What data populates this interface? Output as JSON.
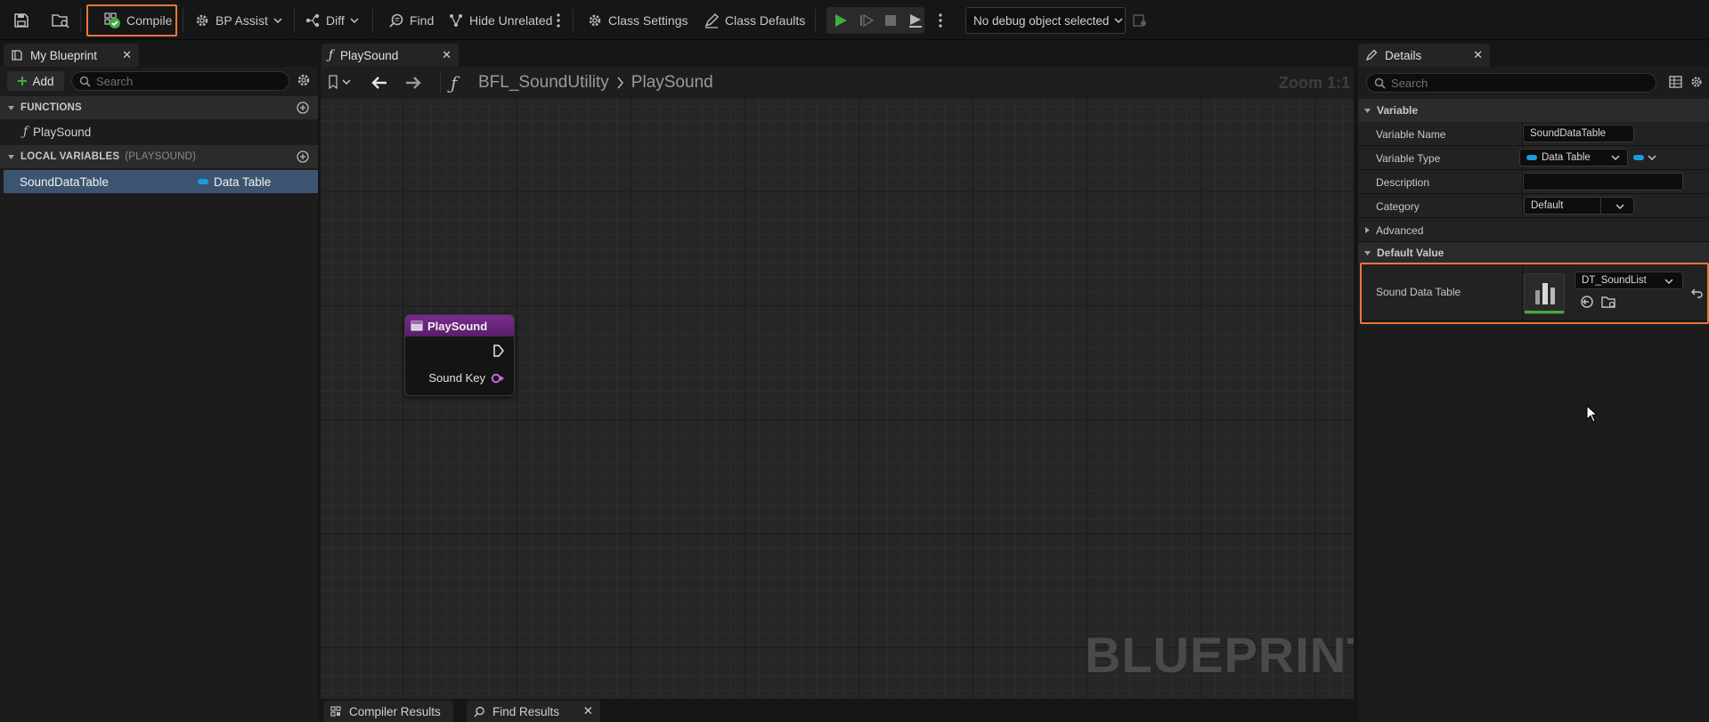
{
  "toolbar": {
    "compile": "Compile",
    "bp_assist": "BP Assist",
    "diff": "Diff",
    "find": "Find",
    "hide_unrelated": "Hide Unrelated",
    "class_settings": "Class Settings",
    "class_defaults": "Class Defaults",
    "debug_object": "No debug object selected"
  },
  "my_blueprint": {
    "tab_title": "My Blueprint",
    "add_label": "Add",
    "search_placeholder": "Search",
    "functions_header": "FUNCTIONS",
    "functions": [
      "PlaySound"
    ],
    "local_vars_header": "LOCAL VARIABLES",
    "local_vars_context": "(PLAYSOUND)",
    "local_vars": [
      {
        "name": "SoundDataTable",
        "type": "Data Table"
      }
    ]
  },
  "graph": {
    "tab_title": "PlaySound",
    "breadcrumb_root": "BFL_SoundUtility",
    "breadcrumb_current": "PlaySound",
    "zoom": "Zoom 1:1",
    "watermark": "BLUEPRINT",
    "node": {
      "title": "PlaySound",
      "pin_label": "Sound Key"
    }
  },
  "bottom_tabs": {
    "compiler_results": "Compiler Results",
    "find_results": "Find Results"
  },
  "details": {
    "tab_title": "Details",
    "search_placeholder": "Search",
    "variable_section": "Variable",
    "variable_name_label": "Variable Name",
    "variable_name_value": "SoundDataTable",
    "variable_type_label": "Variable Type",
    "variable_type_value": "Data Table",
    "description_label": "Description",
    "description_value": "",
    "category_label": "Category",
    "category_value": "Default",
    "advanced_label": "Advanced",
    "default_value_section": "Default Value",
    "sound_data_table_label": "Sound Data Table",
    "sound_data_table_value": "DT_SoundList"
  },
  "colors": {
    "accent_highlight": "#e8773c",
    "data_table_pin": "#1a9de0",
    "function_node": "#7a2b8e",
    "play_green": "#3fae3f",
    "selection": "#3d5470"
  }
}
